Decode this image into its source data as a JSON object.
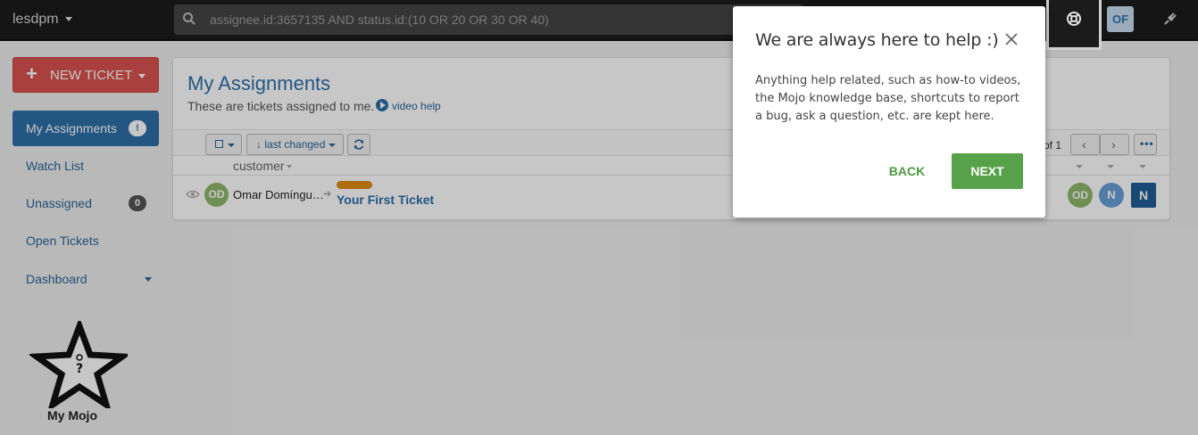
{
  "topbar": {
    "brand": "lesdpm",
    "search_value": "assignee.id:3657135 AND status.id:(10 OR 20 OR 30 OR 40)",
    "user_initials": "OF",
    "icons": [
      "search-icon",
      "lifebuoy-icon",
      "plug-icon"
    ]
  },
  "sidebar": {
    "new_ticket_label": "NEW TICKET",
    "items": [
      {
        "label": "My Assignments",
        "badge": "!"
      },
      {
        "label": "Watch List"
      },
      {
        "label": "Unassigned",
        "badge": "0"
      },
      {
        "label": "Open Tickets"
      },
      {
        "label": "Dashboard"
      }
    ],
    "mymojo_label": "My Mojo"
  },
  "main": {
    "title": "My Assignments",
    "subtitle": "These are tickets assigned to me.",
    "video_help": "video help",
    "sort_label": "↓ last changed",
    "pager_text": "of 1",
    "column_customer": "customer",
    "rows": [
      {
        "initials": "OD",
        "customer": "Omar Domíngu…",
        "title": "Your First Ticket",
        "assignee_initials": [
          "OD",
          "N",
          "N"
        ],
        "priority_color": "#dd8d14"
      }
    ]
  },
  "dialog": {
    "title": "We are always here to help :)",
    "body": "Anything help related, such as how-to videos, the Mojo knowledge base, shortcuts to report a bug, ask a question, etc. are kept here.",
    "back_label": "BACK",
    "next_label": "NEXT"
  },
  "colors": {
    "accent": "#2f6fa7",
    "new_ticket": "#d9534f",
    "next_button": "#57a14a"
  }
}
